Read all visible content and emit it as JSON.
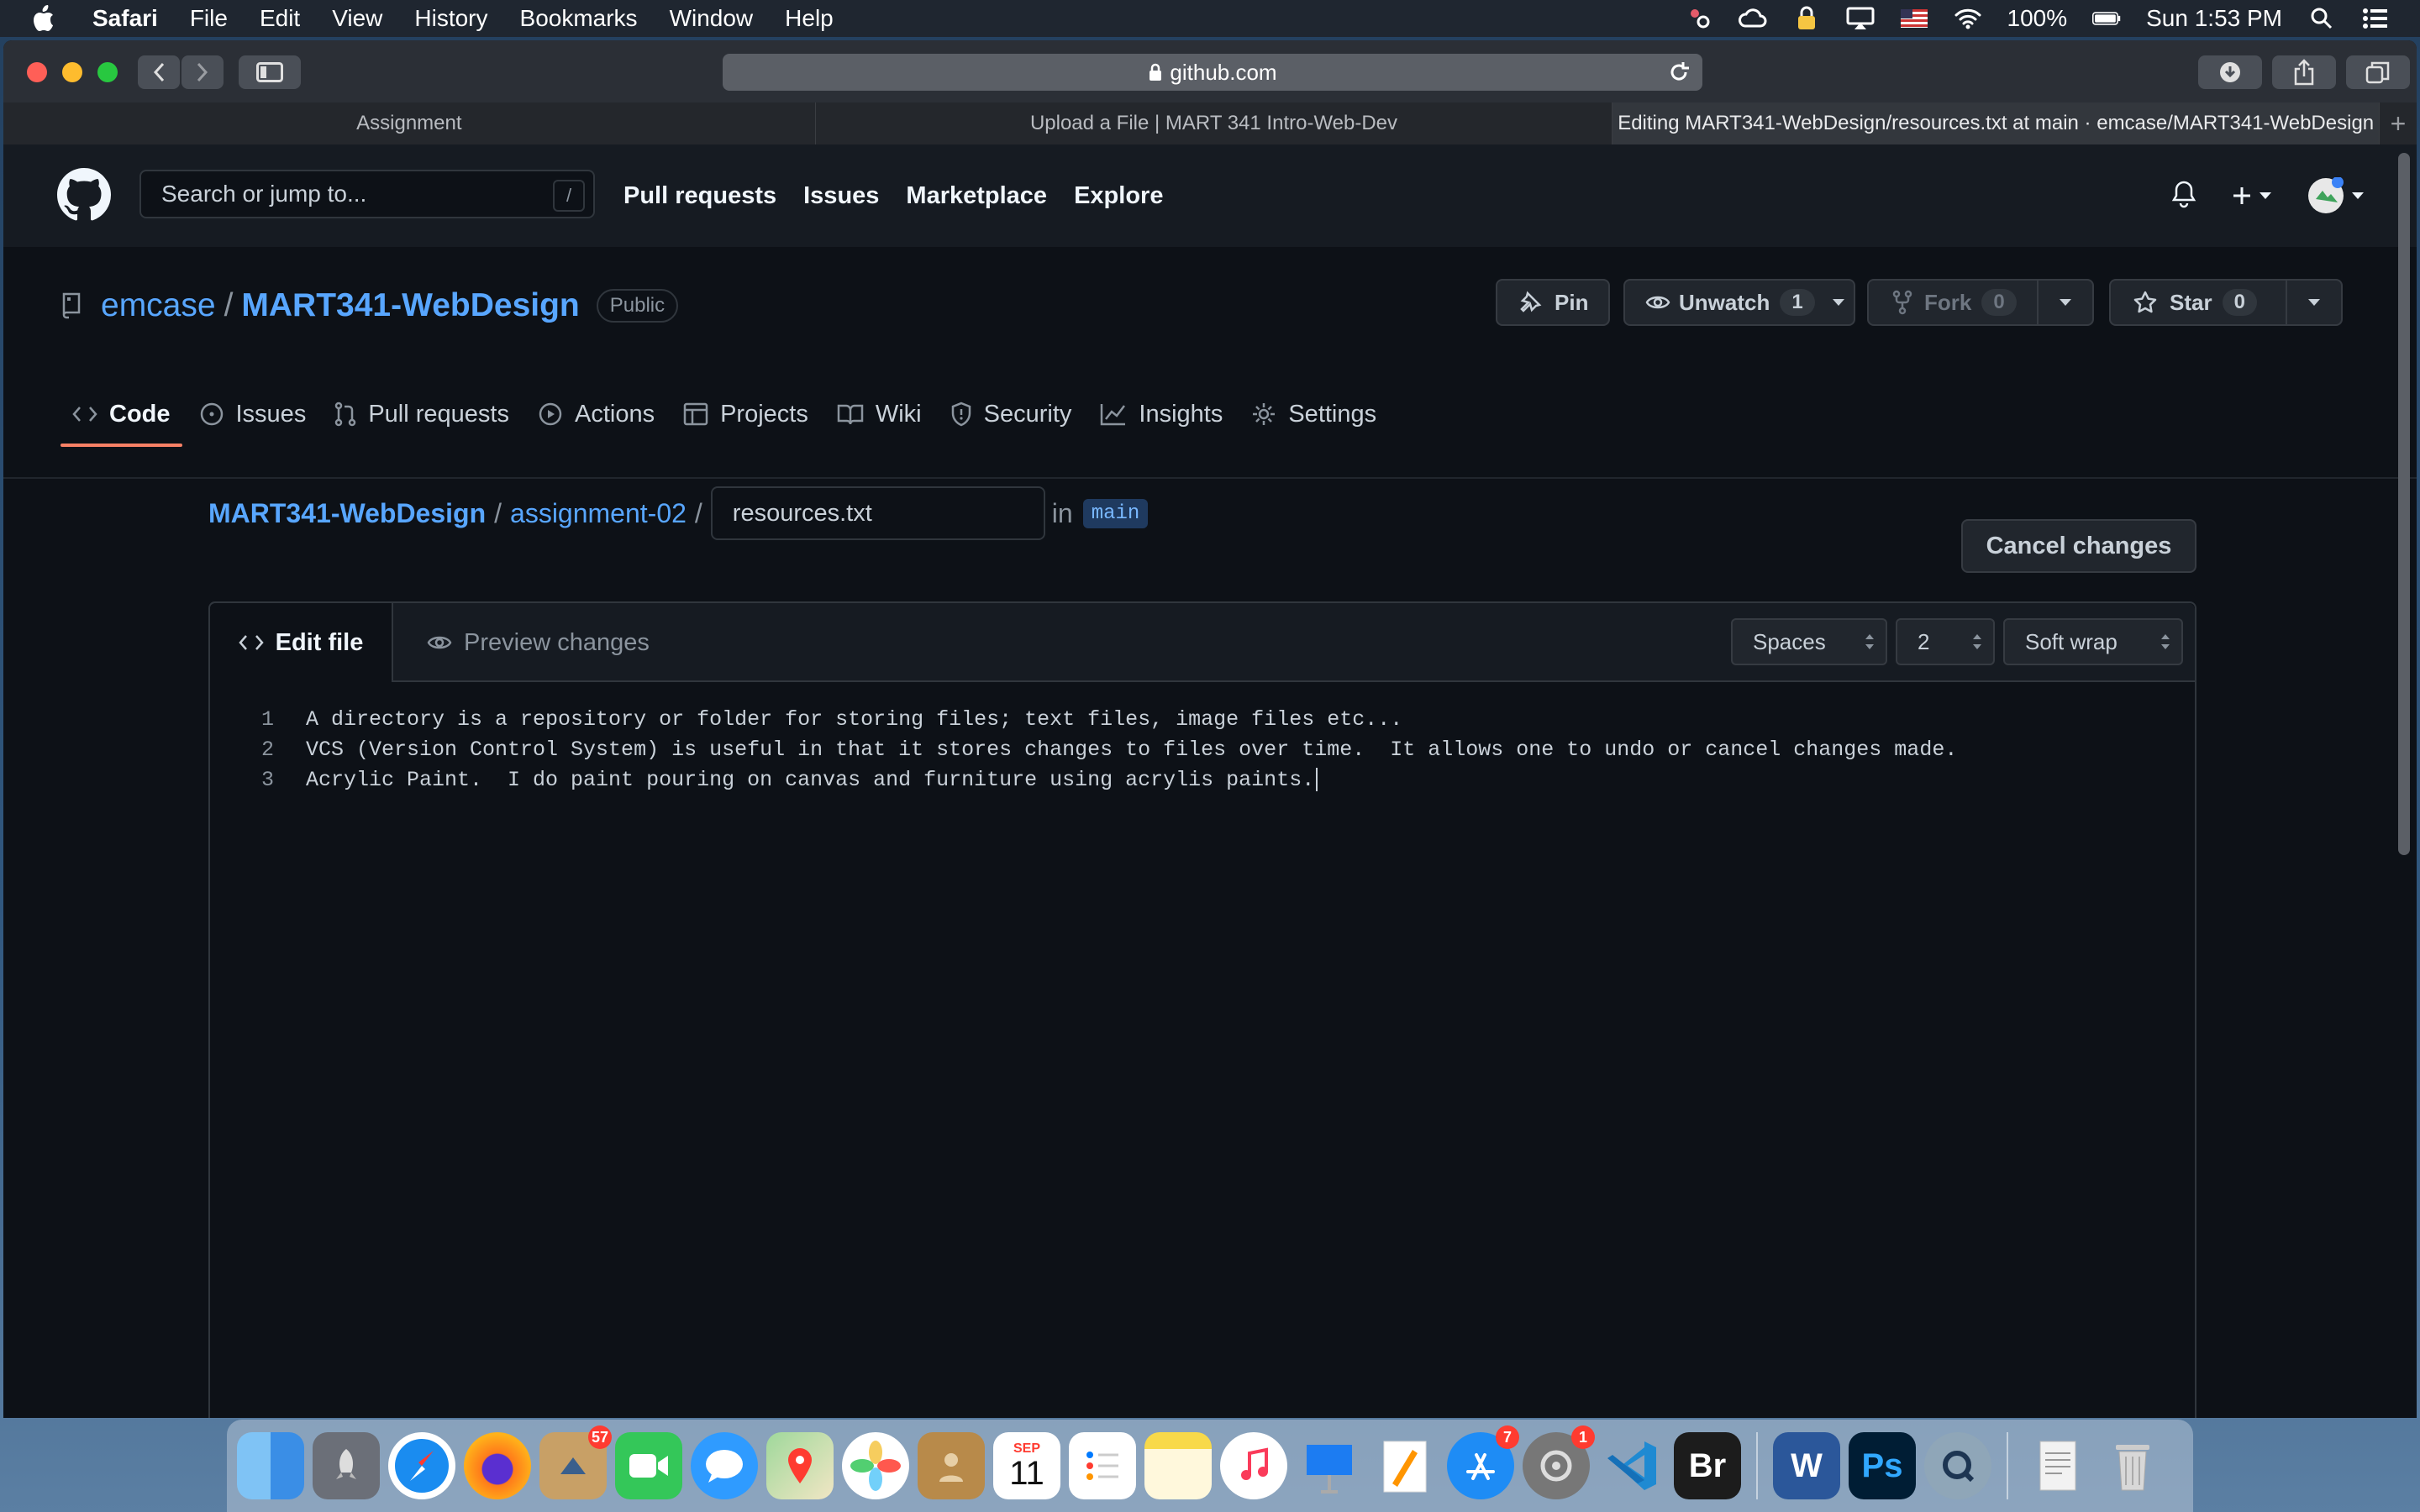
{
  "menubar": {
    "app_name": "Safari",
    "items": [
      "File",
      "Edit",
      "View",
      "History",
      "Bookmarks",
      "Window",
      "Help"
    ],
    "battery": "100%",
    "clock": "Sun 1:53 PM",
    "icons": [
      "apple-icon",
      "wifi-icon",
      "battery-icon",
      "search-icon",
      "control-center-icon"
    ]
  },
  "browser": {
    "url": "github.com",
    "tabs": [
      {
        "label": "Assignment"
      },
      {
        "label": "Upload a File | MART 341 Intro-Web-Dev"
      },
      {
        "label": "Editing MART341-WebDesign/resources.txt at main · emcase/MART341-WebDesign"
      }
    ]
  },
  "gh_header": {
    "search_placeholder": "Search or jump to...",
    "search_shortcut": "/",
    "nav": [
      "Pull requests",
      "Issues",
      "Marketplace",
      "Explore"
    ]
  },
  "repo": {
    "owner": "emcase",
    "separator": "/",
    "name": "MART341-WebDesign",
    "visibility": "Public",
    "pin_label": "Pin",
    "unwatch_label": "Unwatch",
    "unwatch_count": "1",
    "fork_label": "Fork",
    "fork_count": "0",
    "star_label": "Star",
    "star_count": "0",
    "tabs": [
      "Code",
      "Issues",
      "Pull requests",
      "Actions",
      "Projects",
      "Wiki",
      "Security",
      "Insights",
      "Settings"
    ]
  },
  "editor": {
    "breadcrumb_repo": "MART341-WebDesign",
    "breadcrumb_folder": "assignment-02",
    "filename": "resources.txt",
    "in_label": "in",
    "branch": "main",
    "cancel_label": "Cancel changes",
    "edit_tab": "Edit file",
    "preview_tab": "Preview changes",
    "indent_mode": "Spaces",
    "indent_size": "2",
    "wrap_mode": "Soft wrap",
    "lines": [
      {
        "num": "1",
        "text": "A directory is a repository or folder for storing files; text files, image files etc..."
      },
      {
        "num": "2",
        "text": "VCS (Version Control System) is useful in that it stores changes to files over time.  It allows one to undo or cancel changes made."
      },
      {
        "num": "3",
        "text": "Acrylic Paint.  I do paint pouring on canvas and furniture using acrylis paints."
      }
    ]
  },
  "dock": {
    "badges": {
      "mail": "57",
      "app_store": "7",
      "system_prefs": "1"
    },
    "calendar_month": "SEP",
    "calendar_day": "11",
    "bridge_label": "Br",
    "photoshop_label": "Ps",
    "word_label": "W"
  },
  "colors": {
    "gh_bg": "#0d1117",
    "gh_header": "#161b22",
    "link": "#58a6ff",
    "tab_underline": "#f78166"
  }
}
